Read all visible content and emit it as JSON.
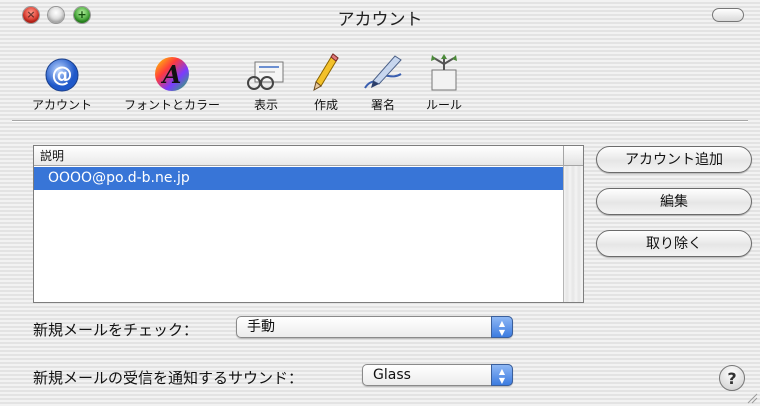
{
  "window": {
    "title": "アカウント"
  },
  "toolbar": {
    "items": [
      {
        "label": "アカウント",
        "icon": "at-sign-icon"
      },
      {
        "label": "フォントとカラー",
        "icon": "font-color-icon"
      },
      {
        "label": "表示",
        "icon": "view-icon"
      },
      {
        "label": "作成",
        "icon": "pencil-icon"
      },
      {
        "label": "署名",
        "icon": "signature-pen-icon"
      },
      {
        "label": "ルール",
        "icon": "rules-icon"
      }
    ]
  },
  "accounts": {
    "header": "説明",
    "rows": [
      "OOOO@po.d-b.ne.jp"
    ]
  },
  "buttons": {
    "add": "アカウント追加",
    "edit": "編集",
    "remove": "取り除く"
  },
  "check_mail": {
    "label": "新規メールをチェック：",
    "value": "手動"
  },
  "sound": {
    "label": "新規メールの受信を通知するサウンド：",
    "value": "Glass"
  },
  "help": {
    "label": "?"
  },
  "colors": {
    "selection": "#3875d7",
    "popup_arrow": "#3c7be0"
  }
}
